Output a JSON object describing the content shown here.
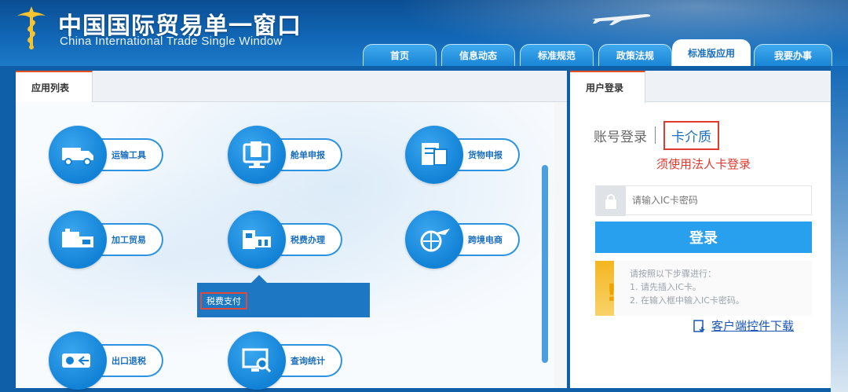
{
  "header": {
    "title": "中国国际贸易单一窗口",
    "subtitle": "China International Trade Single Window"
  },
  "nav": {
    "tabs": [
      {
        "label": "首页"
      },
      {
        "label": "信息动态"
      },
      {
        "label": "标准规范"
      },
      {
        "label": "政策法规"
      },
      {
        "label": "标准版应用"
      },
      {
        "label": "我要办事"
      }
    ],
    "active_index": 4
  },
  "app_list": {
    "tab_label": "应用列表",
    "items": [
      {
        "label": "运输工具",
        "icon": "truck-icon"
      },
      {
        "label": "舱单申报",
        "icon": "manifest-icon"
      },
      {
        "label": "货物申报",
        "icon": "cargo-icon"
      },
      {
        "label": "加工贸易",
        "icon": "processing-icon"
      },
      {
        "label": "税费办理",
        "icon": "tax-icon"
      },
      {
        "label": "跨境电商",
        "icon": "ecommerce-icon"
      },
      {
        "label": "出口退税",
        "icon": "refund-icon"
      },
      {
        "label": "查询统计",
        "icon": "query-icon"
      }
    ],
    "submenu_item": "税费支付"
  },
  "login": {
    "tab_label": "用户登录",
    "mode_account": "账号登录",
    "mode_card": "卡介质",
    "hint": "须使用法人卡登录",
    "pin_placeholder": "请输入IC卡密码",
    "login_button": "登录",
    "notice_title": "请按照以下步骤进行：",
    "notice_step1": "1. 请先插入IC卡。",
    "notice_step2": "2. 在输入框中输入IC卡密码。",
    "download_link": "客户端控件下载"
  },
  "colors": {
    "primary_blue": "#1282d6",
    "login_button": "#29a0ee",
    "highlight_red": "#e03a2f",
    "tab_accent": "#e8501f"
  }
}
